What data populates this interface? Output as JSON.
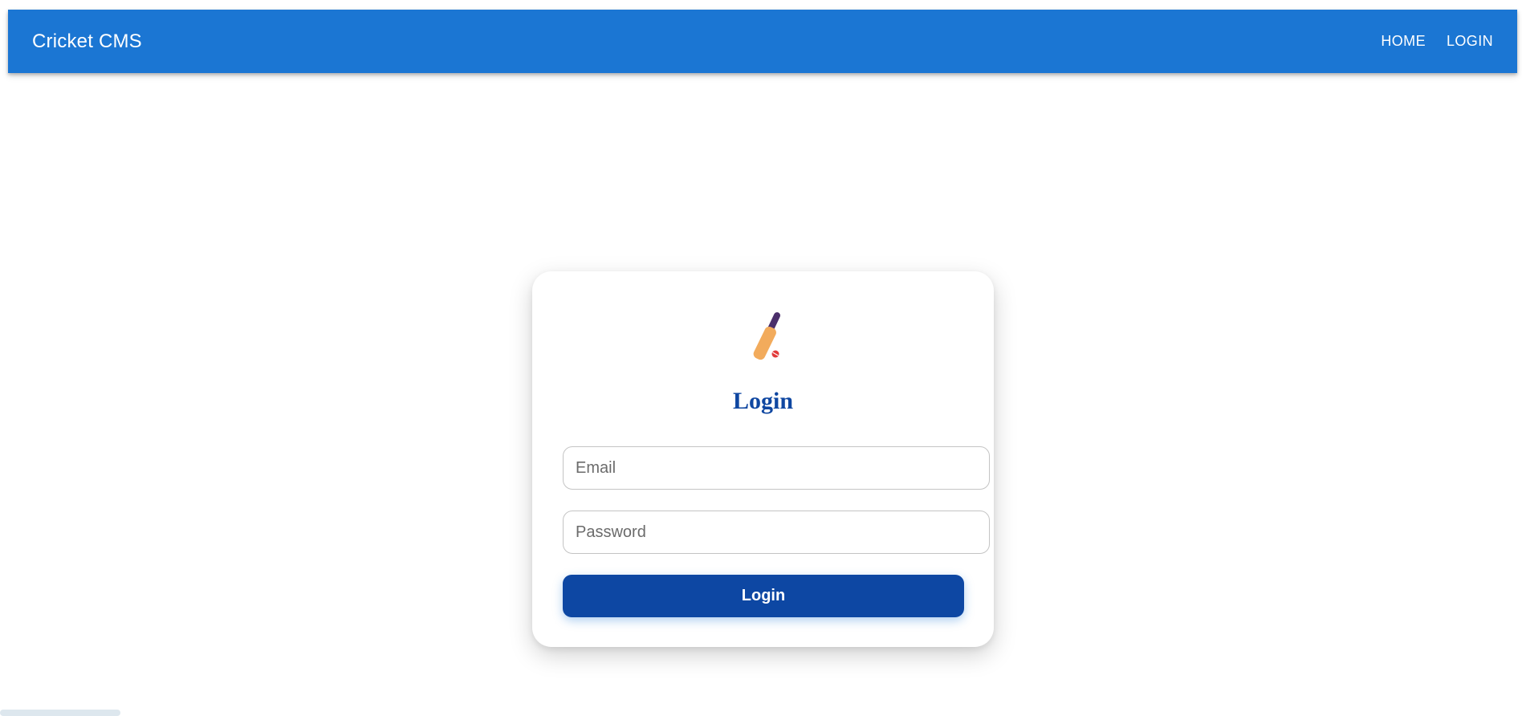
{
  "app": {
    "title": "Cricket CMS"
  },
  "nav": {
    "items": [
      {
        "label": "HOME"
      },
      {
        "label": "LOGIN"
      }
    ]
  },
  "login_card": {
    "logo_icon": "cricket-bat-ball-icon",
    "title": "Login",
    "email": {
      "placeholder": "Email",
      "value": ""
    },
    "password": {
      "placeholder": "Password",
      "value": ""
    },
    "submit_label": "Login"
  },
  "colors": {
    "appbar": "#1b76d3",
    "primary_dark": "#0d47a3",
    "title": "#0f47a1",
    "bat_blade": "#f2ab5c",
    "bat_handle": "#4b2f6b",
    "ball": "#e23b3b"
  }
}
